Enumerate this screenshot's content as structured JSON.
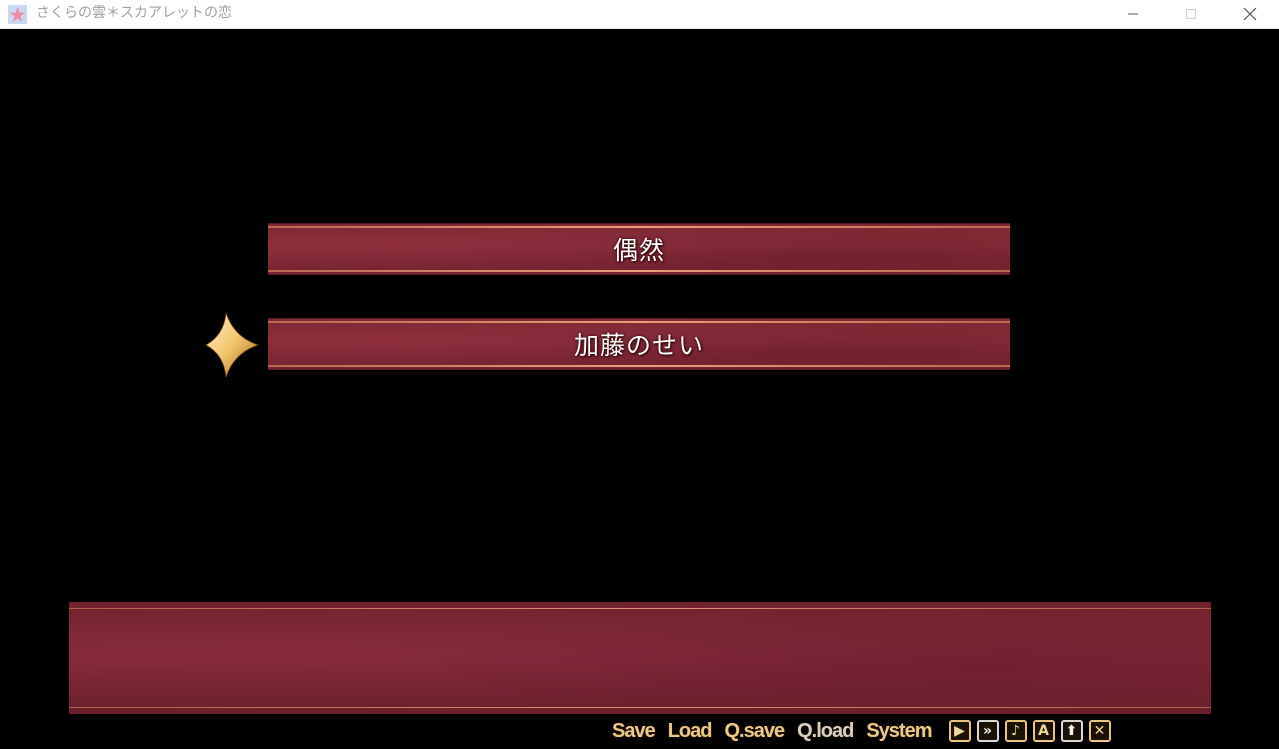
{
  "window": {
    "title": "さくらの雲＊スカアレットの恋"
  },
  "choices": [
    {
      "label": "偶然",
      "selected": false
    },
    {
      "label": "加藤のせい",
      "selected": true
    }
  ],
  "menu": {
    "save": "Save",
    "load": "Load",
    "qsave": "Q.save",
    "qload": "Q.load",
    "system": "System"
  },
  "quick_icons": [
    {
      "name": "auto-play-icon",
      "glyph": "▶"
    },
    {
      "name": "skip-icon",
      "glyph": "»"
    },
    {
      "name": "music-icon",
      "glyph": "♪"
    },
    {
      "name": "text-icon",
      "glyph": "A"
    },
    {
      "name": "hide-window-icon",
      "glyph": "⬆"
    },
    {
      "name": "close-icon",
      "glyph": "✕"
    }
  ],
  "colors": {
    "panel": "#82293a",
    "accent_gold": "#e9c983",
    "border_line": "#e09070"
  }
}
